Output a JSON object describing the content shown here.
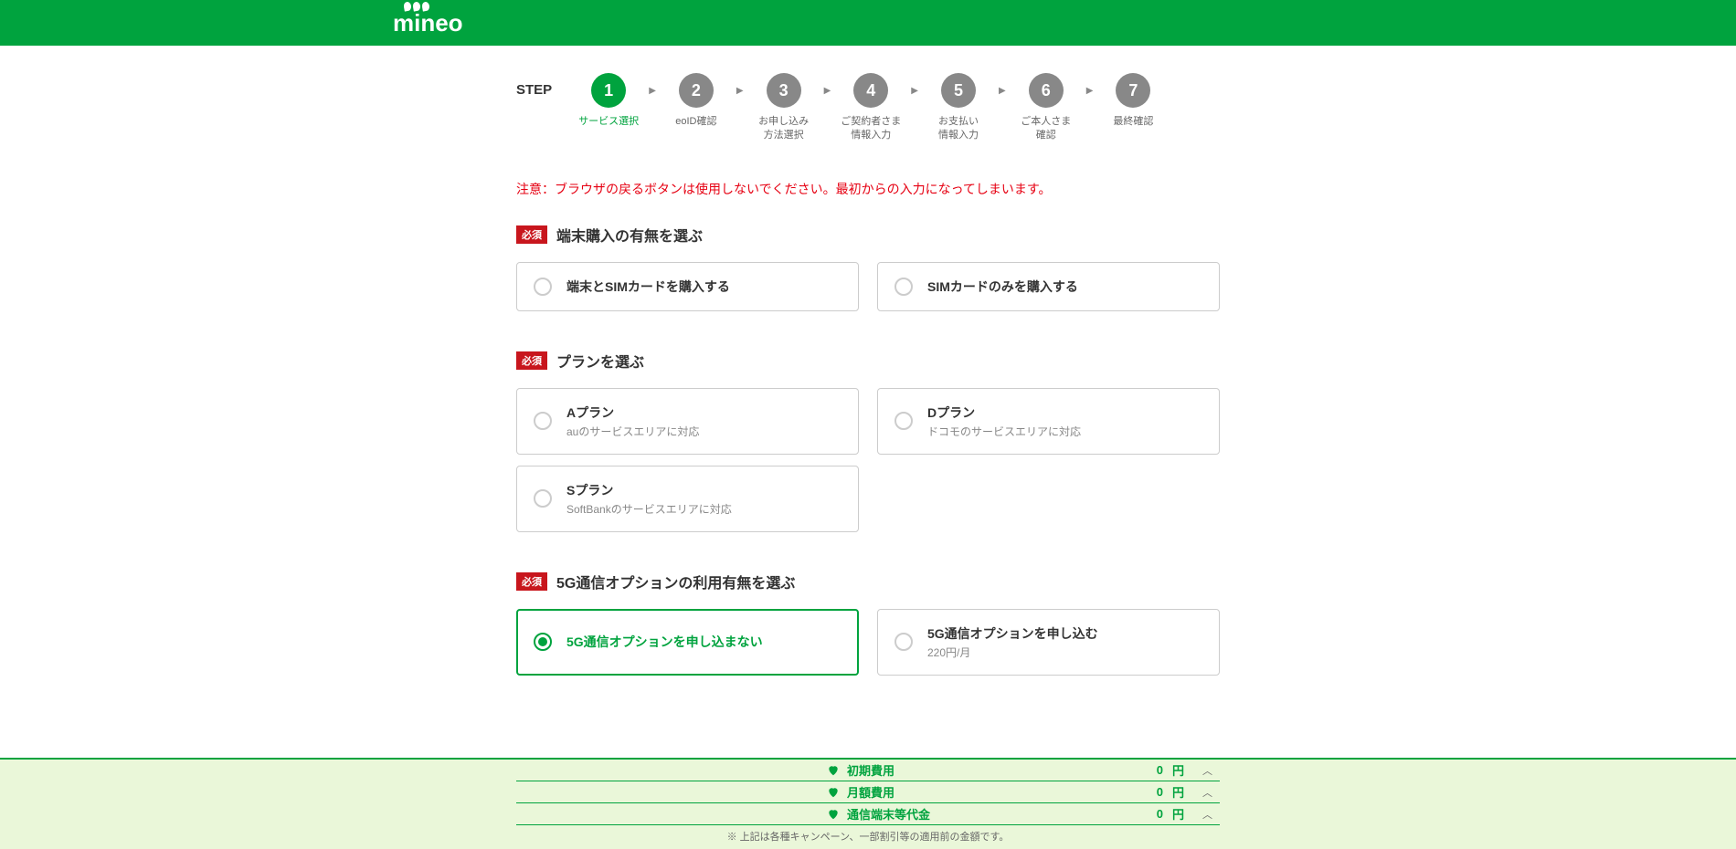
{
  "brand": "mineo",
  "stepper": {
    "label": "STEP",
    "steps": [
      {
        "num": "1",
        "label": "サービス選択",
        "active": true
      },
      {
        "num": "2",
        "label": "eoID確認",
        "active": false
      },
      {
        "num": "3",
        "label": "お申し込み\n方法選択",
        "active": false
      },
      {
        "num": "4",
        "label": "ご契約者さま\n情報入力",
        "active": false
      },
      {
        "num": "5",
        "label": "お支払い\n情報入力",
        "active": false
      },
      {
        "num": "6",
        "label": "ご本人さま\n確認",
        "active": false
      },
      {
        "num": "7",
        "label": "最終確認",
        "active": false
      }
    ]
  },
  "warning": "注意：ブラウザの戻るボタンは使用しないでください。最初からの入力になってしまいます。",
  "required_label": "必須",
  "sections": {
    "terminal": {
      "title": "端末購入の有無を選ぶ",
      "options": [
        {
          "title": "端末とSIMカードを購入する",
          "sub": ""
        },
        {
          "title": "SIMカードのみを購入する",
          "sub": ""
        }
      ]
    },
    "plan": {
      "title": "プランを選ぶ",
      "options": [
        {
          "title": "Aプラン",
          "sub": "auのサービスエリアに対応"
        },
        {
          "title": "Dプラン",
          "sub": "ドコモのサービスエリアに対応"
        },
        {
          "title": "Sプラン",
          "sub": "SoftBankのサービスエリアに対応"
        }
      ]
    },
    "fiveg": {
      "title": "5G通信オプションの利用有無を選ぶ",
      "options": [
        {
          "title": "5G通信オプションを申し込まない",
          "sub": "",
          "selected": true
        },
        {
          "title": "5G通信オプションを申し込む",
          "sub": "220円/月",
          "selected": false
        }
      ]
    }
  },
  "summary": {
    "rows": [
      {
        "label": "初期費用",
        "value": "0",
        "unit": "円"
      },
      {
        "label": "月額費用",
        "value": "0",
        "unit": "円"
      },
      {
        "label": "通信端末等代金",
        "value": "0",
        "unit": "円"
      }
    ],
    "note": "※ 上記は各種キャンペーン、一部割引等の適用前の金額です。"
  }
}
